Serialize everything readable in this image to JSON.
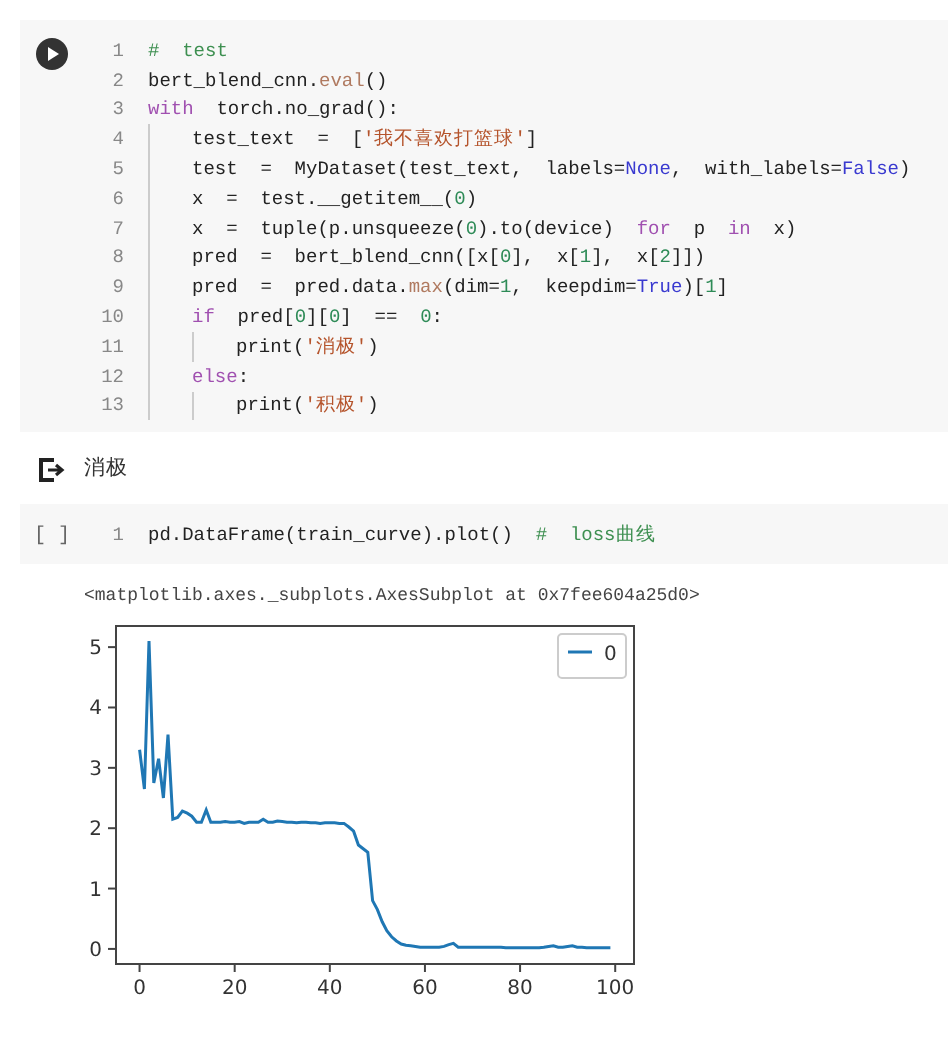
{
  "cells": [
    {
      "kind": "run_button",
      "lines": [
        {
          "number": "1",
          "tokens": [
            {
              "kind": "comment",
              "text": "#  test"
            }
          ]
        },
        {
          "number": "2",
          "tokens": [
            {
              "kind": "plain",
              "text": "bert_blend_cnn."
            },
            {
              "kind": "method",
              "text": "eval"
            },
            {
              "kind": "plain",
              "text": "()"
            }
          ]
        },
        {
          "number": "3",
          "tokens": [
            {
              "kind": "keyword",
              "text": "with"
            },
            {
              "kind": "plain",
              "text": "  torch.no_grad():"
            }
          ],
          "children": [
            {
              "number": "4",
              "tokens": [
                {
                  "kind": "plain",
                  "text": "test_text  =  ["
                },
                {
                  "kind": "string",
                  "text": "'我不喜欢打篮球'"
                },
                {
                  "kind": "plain",
                  "text": "]"
                }
              ]
            },
            {
              "number": "5",
              "tokens": [
                {
                  "kind": "plain",
                  "text": "test  =  MyDataset(test_text,  labels="
                },
                {
                  "kind": "constant",
                  "text": "None"
                },
                {
                  "kind": "plain",
                  "text": ",  with_labels="
                },
                {
                  "kind": "constant",
                  "text": "False"
                },
                {
                  "kind": "plain",
                  "text": ")"
                }
              ]
            },
            {
              "number": "6",
              "tokens": [
                {
                  "kind": "plain",
                  "text": "x  =  test.__getitem__("
                },
                {
                  "kind": "number",
                  "text": "0"
                },
                {
                  "kind": "plain",
                  "text": ")"
                }
              ]
            },
            {
              "number": "7",
              "tokens": [
                {
                  "kind": "plain",
                  "text": "x  =  tuple(p.unsqueeze("
                },
                {
                  "kind": "number",
                  "text": "0"
                },
                {
                  "kind": "plain",
                  "text": ").to(device)  "
                },
                {
                  "kind": "keyword",
                  "text": "for"
                },
                {
                  "kind": "plain",
                  "text": "  p  "
                },
                {
                  "kind": "keyword",
                  "text": "in"
                },
                {
                  "kind": "plain",
                  "text": "  x)"
                }
              ]
            },
            {
              "number": "8",
              "tokens": [
                {
                  "kind": "plain",
                  "text": "pred  =  bert_blend_cnn([x["
                },
                {
                  "kind": "number",
                  "text": "0"
                },
                {
                  "kind": "plain",
                  "text": "],  x["
                },
                {
                  "kind": "number",
                  "text": "1"
                },
                {
                  "kind": "plain",
                  "text": "],  x["
                },
                {
                  "kind": "number",
                  "text": "2"
                },
                {
                  "kind": "plain",
                  "text": "]])"
                }
              ]
            },
            {
              "number": "9",
              "tokens": [
                {
                  "kind": "plain",
                  "text": "pred  =  pred.data."
                },
                {
                  "kind": "method",
                  "text": "max"
                },
                {
                  "kind": "plain",
                  "text": "(dim="
                },
                {
                  "kind": "number",
                  "text": "1"
                },
                {
                  "kind": "plain",
                  "text": ",  keepdim="
                },
                {
                  "kind": "constant",
                  "text": "True"
                },
                {
                  "kind": "plain",
                  "text": ")["
                },
                {
                  "kind": "number",
                  "text": "1"
                },
                {
                  "kind": "plain",
                  "text": "]"
                }
              ]
            },
            {
              "number": "10",
              "tokens": [
                {
                  "kind": "keyword",
                  "text": "if"
                },
                {
                  "kind": "plain",
                  "text": "  pred["
                },
                {
                  "kind": "number",
                  "text": "0"
                },
                {
                  "kind": "plain",
                  "text": "]["
                },
                {
                  "kind": "number",
                  "text": "0"
                },
                {
                  "kind": "plain",
                  "text": "]  ==  "
                },
                {
                  "kind": "number",
                  "text": "0"
                },
                {
                  "kind": "plain",
                  "text": ":"
                }
              ],
              "children": [
                {
                  "number": "11",
                  "tokens": [
                    {
                      "kind": "plain",
                      "text": "print("
                    },
                    {
                      "kind": "string",
                      "text": "'消极'"
                    },
                    {
                      "kind": "plain",
                      "text": ")"
                    }
                  ]
                }
              ]
            },
            {
              "number": "12",
              "tokens": [
                {
                  "kind": "keyword",
                  "text": "else"
                },
                {
                  "kind": "plain",
                  "text": ":"
                }
              ],
              "children": [
                {
                  "number": "13",
                  "tokens": [
                    {
                      "kind": "plain",
                      "text": "print("
                    },
                    {
                      "kind": "string",
                      "text": "'积极'"
                    },
                    {
                      "kind": "plain",
                      "text": ")"
                    }
                  ]
                }
              ]
            }
          ]
        }
      ],
      "output": {
        "kind": "arrow",
        "text": "消极"
      }
    },
    {
      "kind": "run_marker",
      "marker": "[ ]",
      "lines": [
        {
          "number": "1",
          "tokens": [
            {
              "kind": "plain",
              "text": "pd.DataFrame(train_curve).plot()  "
            },
            {
              "kind": "comment",
              "text": "#  loss曲线"
            }
          ]
        }
      ],
      "output": {
        "kind": "plain",
        "text": "<matplotlib.axes._subplots.AxesSubplot at 0x7fee604a25d0>",
        "chart_data": {
          "type": "line",
          "x": [
            0,
            1,
            2,
            3,
            4,
            5,
            6,
            7,
            8,
            9,
            10,
            11,
            12,
            13,
            14,
            15,
            16,
            17,
            18,
            19,
            20,
            21,
            22,
            23,
            24,
            25,
            26,
            27,
            28,
            29,
            30,
            31,
            32,
            33,
            34,
            35,
            36,
            37,
            38,
            39,
            40,
            41,
            42,
            43,
            44,
            45,
            46,
            47,
            48,
            49,
            50,
            51,
            52,
            53,
            54,
            55,
            56,
            57,
            58,
            59,
            60,
            61,
            62,
            63,
            64,
            65,
            66,
            67,
            68,
            69,
            70,
            71,
            72,
            73,
            74,
            75,
            76,
            77,
            78,
            79,
            80,
            81,
            82,
            83,
            84,
            85,
            86,
            87,
            88,
            89,
            90,
            91,
            92,
            93,
            94,
            95,
            96,
            97,
            98,
            99
          ],
          "series": [
            {
              "name": "0",
              "color": "#1f77b4",
              "values": [
                3.3,
                2.65,
                5.1,
                2.75,
                3.15,
                2.5,
                3.55,
                2.15,
                2.18,
                2.28,
                2.25,
                2.2,
                2.1,
                2.1,
                2.3,
                2.1,
                2.1,
                2.1,
                2.11,
                2.1,
                2.1,
                2.11,
                2.08,
                2.1,
                2.1,
                2.1,
                2.15,
                2.1,
                2.1,
                2.12,
                2.11,
                2.1,
                2.1,
                2.09,
                2.1,
                2.1,
                2.09,
                2.09,
                2.08,
                2.09,
                2.09,
                2.09,
                2.08,
                2.08,
                2.02,
                1.95,
                1.72,
                1.66,
                1.6,
                0.8,
                0.65,
                0.45,
                0.3,
                0.2,
                0.13,
                0.08,
                0.06,
                0.05,
                0.04,
                0.03,
                0.03,
                0.03,
                0.03,
                0.03,
                0.04,
                0.07,
                0.09,
                0.03,
                0.03,
                0.03,
                0.03,
                0.03,
                0.03,
                0.03,
                0.03,
                0.03,
                0.03,
                0.02,
                0.02,
                0.02,
                0.02,
                0.02,
                0.02,
                0.02,
                0.02,
                0.03,
                0.04,
                0.05,
                0.03,
                0.03,
                0.04,
                0.05,
                0.03,
                0.03,
                0.02,
                0.02,
                0.02,
                0.02,
                0.02,
                0.02
              ]
            }
          ],
          "xlim": [
            -4.95,
            103.95
          ],
          "ylim": [
            -0.25,
            5.35
          ],
          "xticks": [
            0,
            20,
            40,
            60,
            80,
            100
          ],
          "yticks": [
            0,
            1,
            2,
            3,
            4,
            5
          ]
        }
      }
    }
  ]
}
